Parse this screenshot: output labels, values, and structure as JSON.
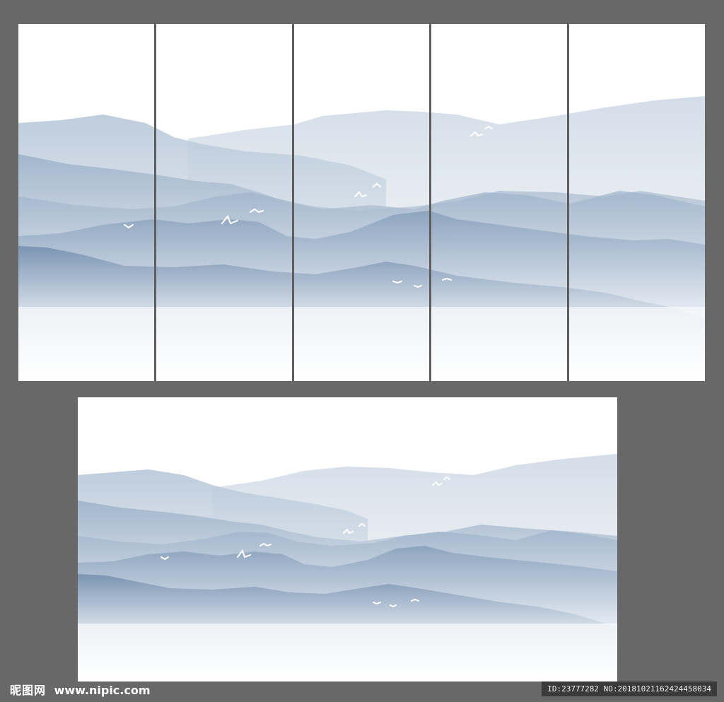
{
  "watermark": {
    "logo_text": "昵图网",
    "site": "www.nipic.com",
    "id_line": "ID:23777282 NO:20181021162424458034"
  },
  "artwork": {
    "screen_panel_count": 5,
    "sky_color": "#ffffff",
    "mountain_colors": [
      "#c9d5e2",
      "#b3c4d6",
      "#9cb1c8",
      "#879fbb",
      "#7690b0"
    ],
    "background_color": "#686868",
    "bird_color": "#ffffff"
  }
}
